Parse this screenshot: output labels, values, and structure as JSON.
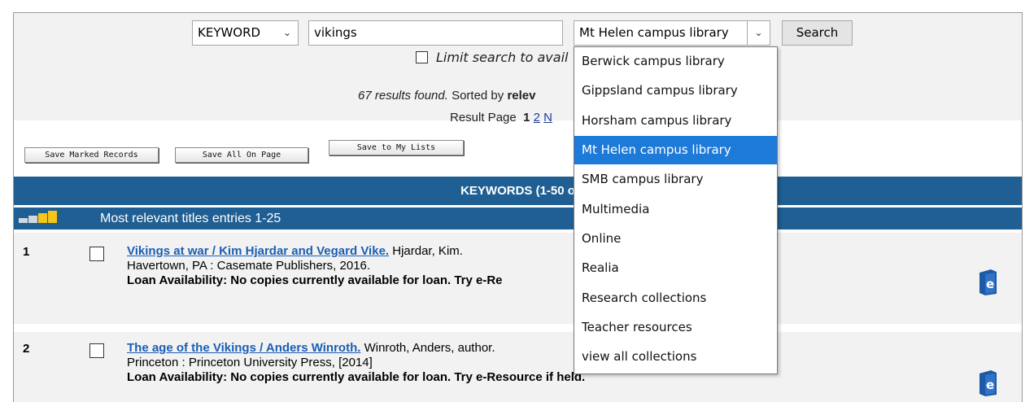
{
  "search": {
    "search_type": "KEYWORD",
    "query": "vikings",
    "collection_selected": "Mt Helen campus library",
    "search_button": "Search",
    "limit_label": "Limit search to avail"
  },
  "results": {
    "found_text": "67 results found.",
    "sorted_prefix": " Sorted by ",
    "sorted_bold": "relev",
    "result_page_label": "Result Page",
    "current_page": "1",
    "next_page": "2",
    "more_link": "N"
  },
  "actions": {
    "save_marked": "Save Marked Records",
    "save_all": "Save All On Page",
    "save_lists": "Save to My Lists"
  },
  "headers": {
    "keywords": "KEYWORDS (1-50 o",
    "relevant": "Most relevant titles entries 1-25"
  },
  "records": [
    {
      "num": "1",
      "title": "Vikings at war / Kim Hjardar and Vegard Vike.",
      "author": " Hjardar, Kim.",
      "publisher": "Havertown, PA : Casemate Publishers, 2016.",
      "loan": "Loan Availability:  No copies currently available for loan. Try e-Re"
    },
    {
      "num": "2",
      "title": "The age of the Vikings / Anders Winroth.",
      "author": " Winroth, Anders, author.",
      "publisher": "Princeton : Princeton University Press, [2014]",
      "loan": "Loan Availability:  No copies currently available for loan. Try e-Resource if held."
    }
  ],
  "icons": {
    "eresource": "e-resource-book-icon",
    "caret": "chevron-down-icon"
  },
  "colors": {
    "header_blue": "#1f5f93",
    "selected_blue": "#1e7ad8",
    "link_blue": "#1a5fb4"
  },
  "dropdown": {
    "options": [
      "Berwick campus library",
      "Gippsland campus library",
      "Horsham campus library",
      "Mt Helen campus library",
      "SMB campus library",
      "Multimedia",
      "Online",
      "Realia",
      "Research collections",
      "Teacher resources",
      "view all collections"
    ]
  }
}
